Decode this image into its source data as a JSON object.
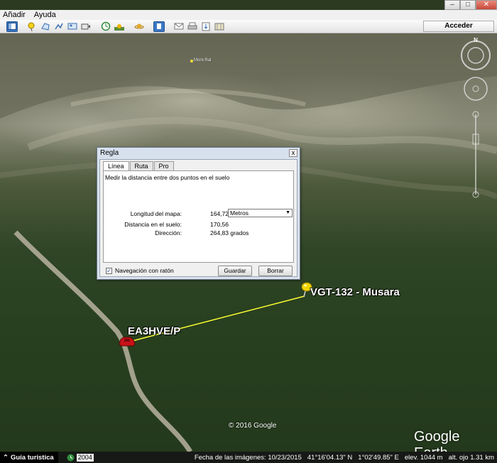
{
  "menu": {
    "items": [
      "Añadir",
      "Ayuda"
    ]
  },
  "window_controls": {
    "minimize": "–",
    "maximize": "□",
    "close": "✕"
  },
  "toolbar": {
    "icons": [
      "sidebar-icon",
      "placemark-icon",
      "polygon-icon",
      "path-icon",
      "image-overlay-icon",
      "record-tour-icon",
      "historical-imagery-icon",
      "sun-icon",
      "planets-icon",
      "ruler-icon",
      "email-icon",
      "print-icon",
      "save-image-icon",
      "maps-icon"
    ],
    "sign_in_label": "Acceder"
  },
  "map": {
    "place_label": "Mont-Ral",
    "pin_label": "VGT-132 - Musara",
    "car_label": "EA3HVE/P",
    "copyright": "© 2016 Google",
    "logo": "Google Earth"
  },
  "ruler_dialog": {
    "title": "Regla",
    "close": "x",
    "tabs": [
      "Línea",
      "Ruta",
      "Pro"
    ],
    "active_tab": "Línea",
    "description": "Medir la distancia entre dos puntos en el suelo",
    "map_length_label": "Longitud del mapa:",
    "map_length_value": "164,72",
    "unit_selected": "Metros",
    "ground_distance_label": "Distancia en el suelo:",
    "ground_distance_value": "170,56",
    "heading_label": "Dirección:",
    "heading_value": "264,83 grados",
    "mouse_nav_label": "Navegación con ratón",
    "mouse_nav_checked": true,
    "save_label": "Guardar",
    "clear_label": "Borrar"
  },
  "statusbar": {
    "tour_guide": "Guía turística",
    "year": "2004",
    "imagery_date": "Fecha de las imágenes: 10/23/2015",
    "latitude": "41°16'04.13\" N",
    "longitude": "1°02'49.85\" E",
    "elevation": "elev.  1044 m",
    "eye_altitude": "alt. ojo   1.31 km"
  },
  "colors": {
    "measure_line": "#ffff33",
    "pushpin": "#f2d600",
    "car_marker": "#c8121a",
    "dialog_frame": "#d7e1ee"
  }
}
